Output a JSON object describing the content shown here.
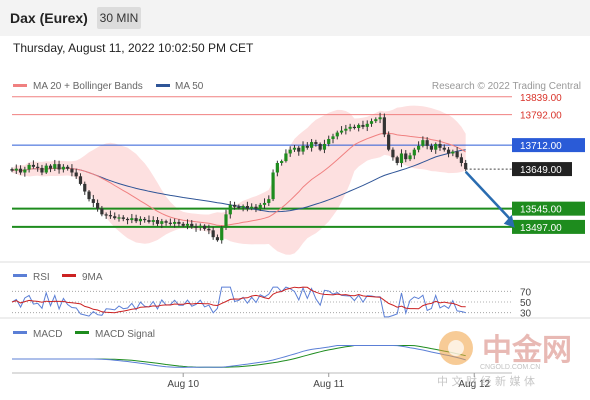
{
  "header": {
    "instrument": "Dax (Eurex)",
    "timeframe": "30 MIN"
  },
  "timestamp": "Thursday, August 11, 2022 10:02:50 PM CET",
  "colors": {
    "ma20": "#f08080",
    "ma50": "#2f5597",
    "resistance": "#f08080",
    "pivot": "#2a5bd7",
    "support": "#1e8c1e",
    "bollinger_fill": "#fde0e0",
    "rsi": "#5b7fd6",
    "rsi_ma": "#cc2222",
    "macd": "#5b7fd6",
    "macd_signal": "#1e8c1e",
    "arrow": "#2a6cb0"
  },
  "watermark": {
    "brand": "中金网",
    "url": "CNGOLD.COM.CN",
    "tagline": "中 文 财 经 新 媒 体"
  },
  "chart_data": {
    "type": "candlestick",
    "title": "Dax (Eurex)",
    "credit": "Research © 2022 Trading Central",
    "legend": {
      "ma": "MA 20 + Bollinger Bands",
      "ma50": "MA 50",
      "rsi": "RSI",
      "rsi_ma": "9MA",
      "macd": "MACD",
      "macd_signal": "MACD Signal"
    },
    "x_labels": [
      {
        "label": "Aug 10",
        "index": 40
      },
      {
        "label": "Aug 11",
        "index": 74
      },
      {
        "label": "Aug 12",
        "index": 108
      }
    ],
    "ylim": [
      13410,
      13870
    ],
    "levels": [
      {
        "value": 13839.0,
        "label": "13839.00",
        "kind": "resistance"
      },
      {
        "value": 13792.0,
        "label": "13792.00",
        "kind": "resistance"
      },
      {
        "value": 13712.0,
        "label": "13712.00",
        "kind": "pivot"
      },
      {
        "value": 13649.0,
        "label": "13649.00",
        "kind": "last"
      },
      {
        "value": 13545.0,
        "label": "13545.00",
        "kind": "support"
      },
      {
        "value": 13497.0,
        "label": "13497.00",
        "kind": "support"
      }
    ],
    "forecast": {
      "from_index": 106,
      "from_value": 13642,
      "to_index": 117,
      "to_value": 13500
    },
    "close": [
      13645,
      13650,
      13640,
      13648,
      13660,
      13655,
      13652,
      13640,
      13658,
      13650,
      13662,
      13648,
      13655,
      13650,
      13640,
      13630,
      13610,
      13590,
      13570,
      13560,
      13545,
      13530,
      13528,
      13525,
      13520,
      13522,
      13518,
      13515,
      13520,
      13512,
      13518,
      13515,
      13510,
      13515,
      13505,
      13512,
      13508,
      13505,
      13510,
      13505,
      13500,
      13505,
      13498,
      13495,
      13500,
      13492,
      13488,
      13470,
      13462,
      13495,
      13530,
      13555,
      13550,
      13548,
      13552,
      13545,
      13550,
      13545,
      13555,
      13560,
      13570,
      13640,
      13665,
      13670,
      13690,
      13700,
      13705,
      13695,
      13710,
      13705,
      13720,
      13715,
      13700,
      13715,
      13728,
      13735,
      13745,
      13750,
      13755,
      13760,
      13757,
      13765,
      13760,
      13768,
      13775,
      13780,
      13785,
      13740,
      13700,
      13680,
      13665,
      13690,
      13675,
      13685,
      13700,
      13710,
      13725,
      13710,
      13700,
      13715,
      13705,
      13700,
      13690,
      13695,
      13680,
      13665,
      13649
    ],
    "rsi_panel": {
      "levels": [
        {
          "value": 70,
          "label": "70"
        },
        {
          "value": 50,
          "label": "50"
        },
        {
          "value": 30,
          "label": "30"
        }
      ],
      "ylim": [
        20,
        80
      ]
    },
    "macd_panel": {
      "ylim": [
        -60,
        60
      ]
    }
  }
}
